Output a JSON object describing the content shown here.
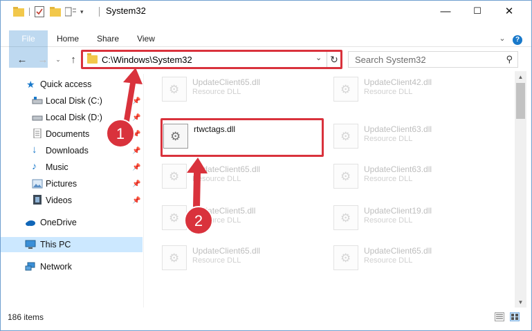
{
  "window": {
    "title": "System32",
    "controls": {
      "minimize": "—",
      "maximize": "☐",
      "close": "✕"
    }
  },
  "ribbon": {
    "tabs": [
      "File",
      "Home",
      "Share",
      "View"
    ],
    "collapse_icon": "chevron-up-icon",
    "help_icon": "help-icon"
  },
  "address_bar": {
    "path": "C:\\Windows\\System32"
  },
  "search": {
    "placeholder": "Search System32"
  },
  "nav": {
    "items": [
      {
        "label": "Quick access",
        "icon": "star-icon",
        "pinned": false
      },
      {
        "label": "Local Disk (C:)",
        "icon": "drive-icon",
        "pinned": true
      },
      {
        "label": "Local Disk (D:)",
        "icon": "drive-icon",
        "pinned": true
      },
      {
        "label": "Documents",
        "icon": "documents-icon",
        "pinned": true
      },
      {
        "label": "Downloads",
        "icon": "downloads-icon",
        "pinned": true
      },
      {
        "label": "Music",
        "icon": "music-icon",
        "pinned": true
      },
      {
        "label": "Pictures",
        "icon": "pictures-icon",
        "pinned": true
      },
      {
        "label": "Videos",
        "icon": "videos-icon",
        "pinned": true
      },
      {
        "label": "OneDrive",
        "icon": "onedrive-icon",
        "pinned": false
      },
      {
        "label": "This PC",
        "icon": "pc-icon",
        "pinned": false,
        "selected": true
      },
      {
        "label": "Network",
        "icon": "network-icon",
        "pinned": false
      }
    ]
  },
  "files": [
    {
      "name": "UpdateClient65.dll",
      "type": "Resource DLL",
      "faded": true
    },
    {
      "name": "UpdateClient42.dll",
      "type": "Resource DLL",
      "faded": true
    },
    {
      "name": "rtwctags.dll",
      "type": "",
      "faded": false,
      "highlighted": true
    },
    {
      "name": "UpdateClient63.dll",
      "type": "Resource DLL",
      "faded": true
    },
    {
      "name": "UpdateClient65.dll",
      "type": "Resource DLL",
      "faded": true
    },
    {
      "name": "UpdateClient63.dll",
      "type": "Resource DLL",
      "faded": true
    },
    {
      "name": "UpdateClient5.dll",
      "type": "Resource DLL",
      "faded": true
    },
    {
      "name": "UpdateClient19.dll",
      "type": "Resource DLL",
      "faded": true
    },
    {
      "name": "UpdateClient65.dll",
      "type": "Resource DLL",
      "faded": true
    },
    {
      "name": "UpdateClient65.dll",
      "type": "Resource DLL",
      "faded": true
    }
  ],
  "status": {
    "item_count": "186 items"
  },
  "annotations": {
    "step1": "1",
    "step2": "2",
    "accent_color": "#d9323c"
  },
  "colors": {
    "file_tab": "#1979ca",
    "selection": "#cce8ff",
    "highlight_border": "#d9323c"
  }
}
